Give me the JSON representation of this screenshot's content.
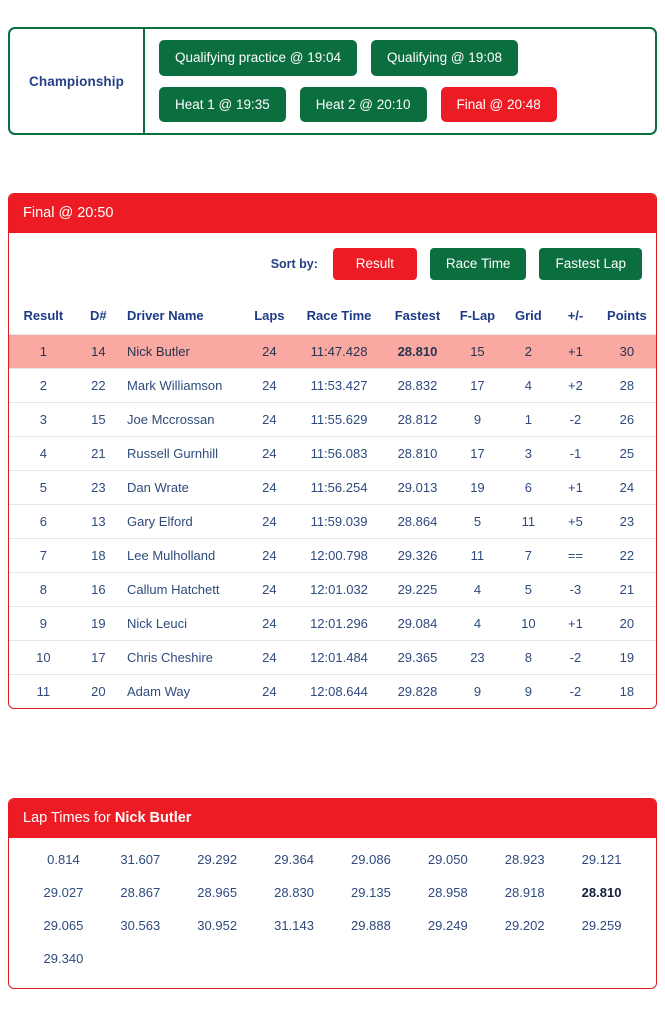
{
  "session_bar": {
    "label": "Championship",
    "rows": [
      [
        {
          "label": "Qualifying practice @ 19:04",
          "state": "inactive"
        },
        {
          "label": "Qualifying @ 19:08",
          "state": "inactive"
        }
      ],
      [
        {
          "label": "Heat 1 @ 19:35",
          "state": "inactive"
        },
        {
          "label": "Heat 2 @ 20:10",
          "state": "inactive"
        },
        {
          "label": "Final @ 20:48",
          "state": "active"
        }
      ]
    ]
  },
  "results_panel": {
    "title": "Final @ 20:50",
    "sort": {
      "label": "Sort by:",
      "options": [
        {
          "label": "Result",
          "state": "active"
        },
        {
          "label": "Race Time",
          "state": "inactive"
        },
        {
          "label": "Fastest Lap",
          "state": "inactive"
        }
      ]
    },
    "columns": [
      "Result",
      "D#",
      "Driver Name",
      "Laps",
      "Race Time",
      "Fastest",
      "F-Lap",
      "Grid",
      "+/-",
      "Points"
    ],
    "rows": [
      {
        "result": "1",
        "dn": "14",
        "name": "Nick Butler",
        "laps": "24",
        "race_time": "11:47.428",
        "fastest": "28.810",
        "flap": "15",
        "grid": "2",
        "delta": "+1",
        "delta_sign": "pos",
        "points": "30",
        "highlight": true,
        "fastest_best": true
      },
      {
        "result": "2",
        "dn": "22",
        "name": "Mark Williamson",
        "laps": "24",
        "race_time": "11:53.427",
        "fastest": "28.832",
        "flap": "17",
        "grid": "4",
        "delta": "+2",
        "delta_sign": "pos",
        "points": "28",
        "highlight": false,
        "fastest_best": false
      },
      {
        "result": "3",
        "dn": "15",
        "name": "Joe Mccrossan",
        "laps": "24",
        "race_time": "11:55.629",
        "fastest": "28.812",
        "flap": "9",
        "grid": "1",
        "delta": "-2",
        "delta_sign": "neg",
        "points": "26",
        "highlight": false,
        "fastest_best": false
      },
      {
        "result": "4",
        "dn": "21",
        "name": "Russell Gurnhill",
        "laps": "24",
        "race_time": "11:56.083",
        "fastest": "28.810",
        "flap": "17",
        "grid": "3",
        "delta": "-1",
        "delta_sign": "neg",
        "points": "25",
        "highlight": false,
        "fastest_best": false
      },
      {
        "result": "5",
        "dn": "23",
        "name": "Dan Wrate",
        "laps": "24",
        "race_time": "11:56.254",
        "fastest": "29.013",
        "flap": "19",
        "grid": "6",
        "delta": "+1",
        "delta_sign": "pos",
        "points": "24",
        "highlight": false,
        "fastest_best": false
      },
      {
        "result": "6",
        "dn": "13",
        "name": "Gary Elford",
        "laps": "24",
        "race_time": "11:59.039",
        "fastest": "28.864",
        "flap": "5",
        "grid": "11",
        "delta": "+5",
        "delta_sign": "pos",
        "points": "23",
        "highlight": false,
        "fastest_best": false
      },
      {
        "result": "7",
        "dn": "18",
        "name": "Lee Mulholland",
        "laps": "24",
        "race_time": "12:00.798",
        "fastest": "29.326",
        "flap": "11",
        "grid": "7",
        "delta": "==",
        "delta_sign": "eq",
        "points": "22",
        "highlight": false,
        "fastest_best": false
      },
      {
        "result": "8",
        "dn": "16",
        "name": "Callum Hatchett",
        "laps": "24",
        "race_time": "12:01.032",
        "fastest": "29.225",
        "flap": "4",
        "grid": "5",
        "delta": "-3",
        "delta_sign": "neg",
        "points": "21",
        "highlight": false,
        "fastest_best": false
      },
      {
        "result": "9",
        "dn": "19",
        "name": "Nick Leuci",
        "laps": "24",
        "race_time": "12:01.296",
        "fastest": "29.084",
        "flap": "4",
        "grid": "10",
        "delta": "+1",
        "delta_sign": "pos",
        "points": "20",
        "highlight": false,
        "fastest_best": false
      },
      {
        "result": "10",
        "dn": "17",
        "name": "Chris Cheshire",
        "laps": "24",
        "race_time": "12:01.484",
        "fastest": "29.365",
        "flap": "23",
        "grid": "8",
        "delta": "-2",
        "delta_sign": "neg",
        "points": "19",
        "highlight": false,
        "fastest_best": false
      },
      {
        "result": "11",
        "dn": "20",
        "name": "Adam Way",
        "laps": "24",
        "race_time": "12:08.644",
        "fastest": "29.828",
        "flap": "9",
        "grid": "9",
        "delta": "-2",
        "delta_sign": "neg",
        "points": "18",
        "highlight": false,
        "fastest_best": false
      }
    ]
  },
  "laps_panel": {
    "title_prefix": "Lap Times for ",
    "driver": "Nick Butler",
    "lap_times": [
      {
        "value": "0.814",
        "best": false
      },
      {
        "value": "31.607",
        "best": false
      },
      {
        "value": "29.292",
        "best": false
      },
      {
        "value": "29.364",
        "best": false
      },
      {
        "value": "29.086",
        "best": false
      },
      {
        "value": "29.050",
        "best": false
      },
      {
        "value": "28.923",
        "best": false
      },
      {
        "value": "29.121",
        "best": false
      },
      {
        "value": "29.027",
        "best": false
      },
      {
        "value": "28.867",
        "best": false
      },
      {
        "value": "28.965",
        "best": false
      },
      {
        "value": "28.830",
        "best": false
      },
      {
        "value": "29.135",
        "best": false
      },
      {
        "value": "28.958",
        "best": false
      },
      {
        "value": "28.918",
        "best": false
      },
      {
        "value": "28.810",
        "best": true
      },
      {
        "value": "29.065",
        "best": false
      },
      {
        "value": "30.563",
        "best": false
      },
      {
        "value": "30.952",
        "best": false
      },
      {
        "value": "31.143",
        "best": false
      },
      {
        "value": "29.888",
        "best": false
      },
      {
        "value": "29.249",
        "best": false
      },
      {
        "value": "29.202",
        "best": false
      },
      {
        "value": "29.259",
        "best": false
      },
      {
        "value": "29.340",
        "best": false
      }
    ]
  },
  "colors": {
    "green": "#0a6e3f",
    "red": "#ed1c24",
    "highlight_row": "#f9a8a2",
    "text_blue": "#2f4a7d",
    "positive": "#5cb85c",
    "negative": "#e8403a"
  }
}
